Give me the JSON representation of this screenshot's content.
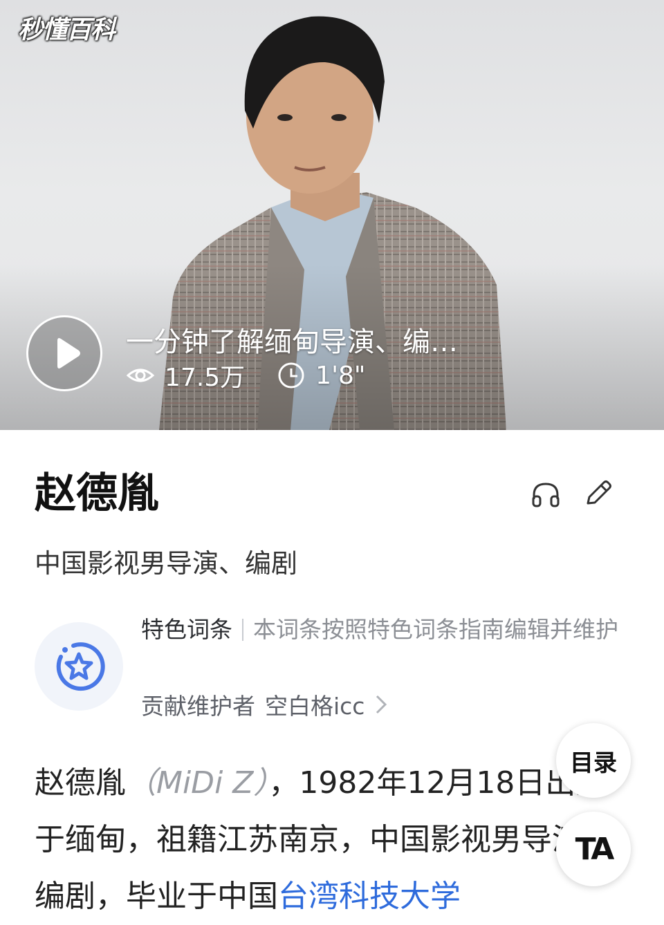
{
  "video": {
    "logo_text": "秒懂百科",
    "title": "一分钟了解缅甸导演、编…",
    "views": "17.5万",
    "duration": "1'8\"",
    "icons": {
      "play": "play-icon",
      "views": "eye-icon",
      "duration": "clock-icon"
    }
  },
  "entry": {
    "title": "赵德胤",
    "subtitle": "中国影视男导演、编剧",
    "icons": {
      "listen": "headphones-icon",
      "edit": "pencil-icon"
    }
  },
  "feature": {
    "label": "特色词条",
    "description": "本词条按照特色词条指南编辑并维护",
    "contributor_label": "贡献维护者",
    "contributor_name": "空白格icc",
    "icon": "star-badge-icon"
  },
  "body": {
    "name": "赵德胤",
    "english_name": "（MiDi Z）",
    "text_1": "，1982年12月18日出生于缅甸，祖籍江苏南京，中国影视男导演、编剧，毕业于中国",
    "link_text": "台湾科技大学"
  },
  "floating": {
    "toc_label": "目录",
    "font_label": "TA"
  },
  "colors": {
    "link": "#2e6bdc",
    "badge": "#4a78e6",
    "badge_bg": "#f1f4fa"
  }
}
